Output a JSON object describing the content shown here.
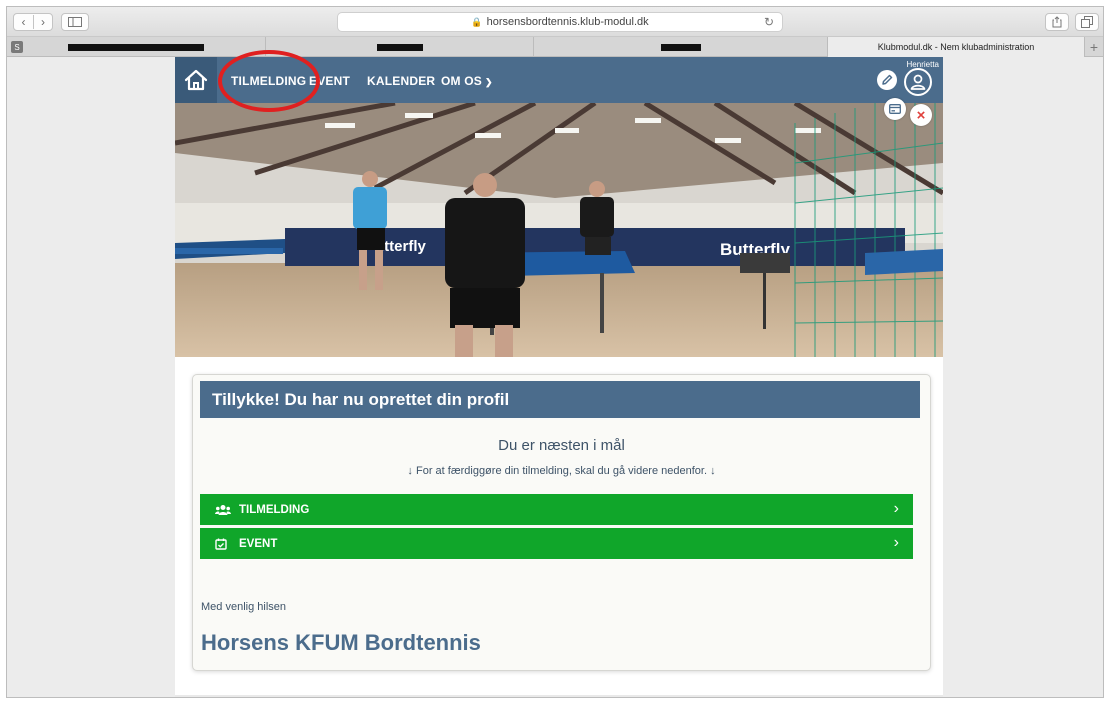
{
  "browser": {
    "url": "horsensbordtennis.klub-modul.dk",
    "tabs": [
      {
        "label": "",
        "redacted": true,
        "favicon": "S"
      },
      {
        "label": "",
        "redacted": true
      },
      {
        "label": "",
        "redacted": true
      },
      {
        "label": "Klubmodul.dk - Nem klubadministration",
        "active": true
      }
    ],
    "new_tab_label": "+"
  },
  "nav": {
    "items": [
      {
        "label": "TILMELDING"
      },
      {
        "label": "EVENT"
      },
      {
        "label": "KALENDER"
      },
      {
        "label": "OM OS"
      }
    ],
    "user_name": "Henrietta"
  },
  "card": {
    "header": "Tillykke! Du har nu oprettet din profil",
    "subtitle": "Du er næsten i mål",
    "instructions": "↓ For at færdiggøre din tilmelding, skal du gå videre nedenfor. ↓",
    "buttons": [
      {
        "label": "TILMELDING",
        "icon": "users-icon"
      },
      {
        "label": "EVENT",
        "icon": "calendar-check-icon"
      }
    ],
    "regards": "Med venlig hilsen",
    "club_name": "Horsens KFUM Bordtennis"
  },
  "colors": {
    "nav_blue": "#4b6c8c",
    "action_green": "#10a62a",
    "annotation_red": "#e02020"
  }
}
